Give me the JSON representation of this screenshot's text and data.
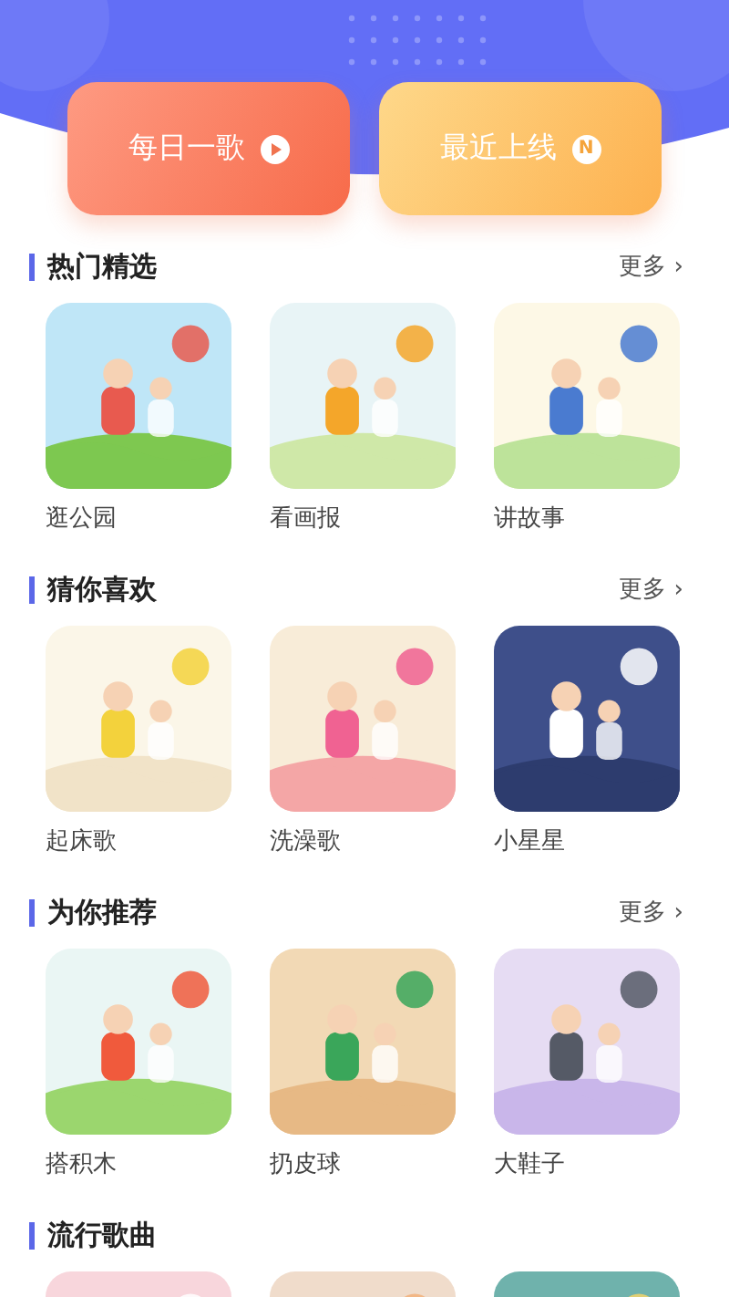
{
  "header_buttons": [
    {
      "label": "每日一歌",
      "kind": "play"
    },
    {
      "label": "最近上线",
      "kind": "badge",
      "badge": "N"
    }
  ],
  "sections": [
    {
      "title": "热门精选",
      "more": "更多",
      "more_arrow": "›",
      "items": [
        {
          "kind": "picture",
          "label": "逛公园"
        },
        {
          "kind": "picture",
          "label": "看画报"
        },
        {
          "kind": "picture",
          "label": "讲故事"
        }
      ]
    },
    {
      "title": "猜你喜欢",
      "more": "更多",
      "more_arrow": "›",
      "items": [
        {
          "kind": "picture",
          "label": "起床歌"
        },
        {
          "kind": "picture",
          "label": "洗澡歌"
        },
        {
          "kind": "picture",
          "label": "小星星"
        }
      ]
    },
    {
      "title": "为你推荐",
      "more": "更多",
      "more_arrow": "›",
      "items": [
        {
          "kind": "picture",
          "label": "搭积木"
        },
        {
          "kind": "picture",
          "label": "扔皮球"
        },
        {
          "kind": "picture",
          "label": "大鞋子"
        }
      ]
    },
    {
      "title": "流行歌曲"
    }
  ]
}
